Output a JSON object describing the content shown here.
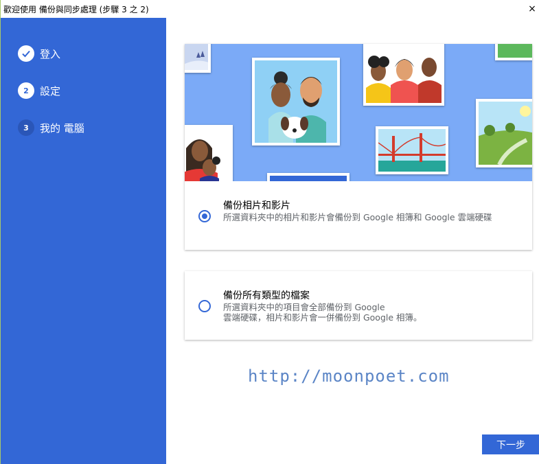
{
  "window": {
    "title": "歡迎使用 備份與同步處理 (步驟 3 之 2)",
    "close_glyph": "×"
  },
  "sidebar": {
    "steps": [
      {
        "number": "",
        "label": "登入",
        "state": "done"
      },
      {
        "number": "2",
        "label": "設定",
        "state": "current"
      },
      {
        "number": "3",
        "label": "我的 電腦",
        "state": "future"
      }
    ]
  },
  "options": [
    {
      "title": "備份相片和影片",
      "description": "所選資料夾中的相片和影片會備份到 Google 相簿和 Google 雲端硬碟",
      "selected": true
    },
    {
      "title": "備份所有類型的檔案",
      "description_line1": "所選資料夾中的項目會全部備份到 Google",
      "description_line2": "雲端硬碟，相片和影片會一併備份到 Google 相簿。",
      "selected": false
    }
  ],
  "watermark": "http://moonpoet.com",
  "footer": {
    "next_label": "下一步"
  },
  "colors": {
    "accent": "#3367d6",
    "hero_bg": "#7baaf7"
  }
}
